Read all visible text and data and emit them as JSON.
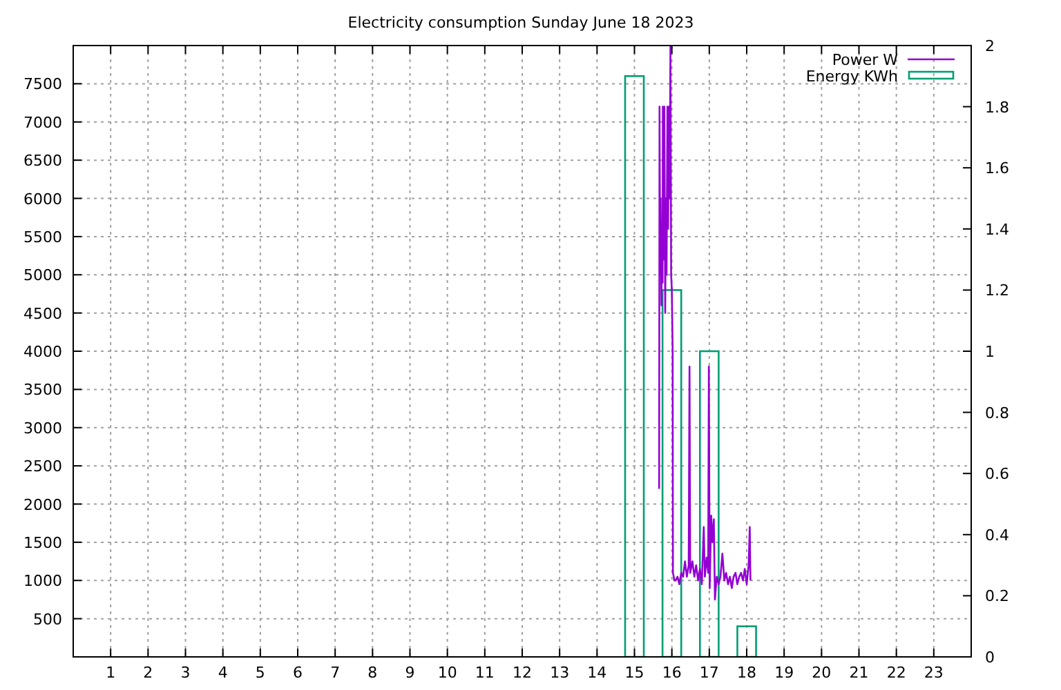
{
  "title": "Electricity consumption Sunday June 18 2023",
  "chart_data": {
    "type": "line",
    "grid": true,
    "xlim": [
      0,
      24
    ],
    "ylim": [
      0,
      8000
    ],
    "y2lim": [
      0,
      2
    ],
    "xticks": [
      1,
      2,
      3,
      4,
      5,
      6,
      7,
      8,
      9,
      10,
      11,
      12,
      13,
      14,
      15,
      16,
      17,
      18,
      19,
      20,
      21,
      22,
      23
    ],
    "yticks": [
      500,
      1000,
      1500,
      2000,
      2500,
      3000,
      3500,
      4000,
      4500,
      5000,
      5500,
      6000,
      6500,
      7000,
      7500
    ],
    "y2ticks": [
      0,
      0.2,
      0.4,
      0.6,
      0.8,
      1,
      1.2,
      1.4,
      1.6,
      1.8,
      2
    ],
    "series": [
      {
        "name": "Power W",
        "color": "#9400d3",
        "x": [
          15.66,
          15.67,
          15.69,
          15.7,
          15.72,
          15.73,
          15.75,
          15.76,
          15.78,
          15.8,
          15.82,
          15.84,
          15.86,
          15.88,
          15.9,
          15.92,
          15.94,
          15.96,
          15.98,
          16.0,
          16.02,
          16.03,
          16.05,
          16.06,
          16.1,
          16.15,
          16.2,
          16.25,
          16.3,
          16.35,
          16.4,
          16.45,
          16.47,
          16.49,
          16.55,
          16.6,
          16.65,
          16.7,
          16.75,
          16.8,
          16.85,
          16.88,
          16.93,
          16.97,
          16.99,
          17.01,
          17.05,
          17.08,
          17.12,
          17.15,
          17.2,
          17.25,
          17.3,
          17.35,
          17.4,
          17.45,
          17.5,
          17.55,
          17.6,
          17.65,
          17.7,
          17.75,
          17.8,
          17.85,
          17.9,
          17.95,
          18.0,
          18.05,
          18.08,
          18.1
        ],
        "values": [
          2200,
          7200,
          5000,
          6000,
          4600,
          5500,
          4900,
          7200,
          5200,
          7200,
          4500,
          6000,
          5000,
          7200,
          5600,
          7200,
          6000,
          8000,
          5000,
          4800,
          4000,
          1100,
          1050,
          1000,
          1000,
          1050,
          950,
          1100,
          1050,
          1250,
          1050,
          1200,
          3800,
          1100,
          1250,
          1050,
          1200,
          1000,
          1150,
          950,
          1700,
          1050,
          1300,
          1100,
          3800,
          900,
          1850,
          1500,
          1800,
          750,
          1050,
          950,
          1050,
          1350,
          1000,
          1100,
          950,
          1050,
          900,
          1050,
          1100,
          950,
          1050,
          1100,
          1000,
          1150,
          950,
          1200,
          1700,
          1000
        ]
      },
      {
        "name": "Energy KWh",
        "color": "#009e73",
        "type": "bar",
        "axis": "y2",
        "x": [
          15,
          16,
          17,
          18
        ],
        "values": [
          1.9,
          1.2,
          1.0,
          0.1
        ]
      }
    ]
  }
}
